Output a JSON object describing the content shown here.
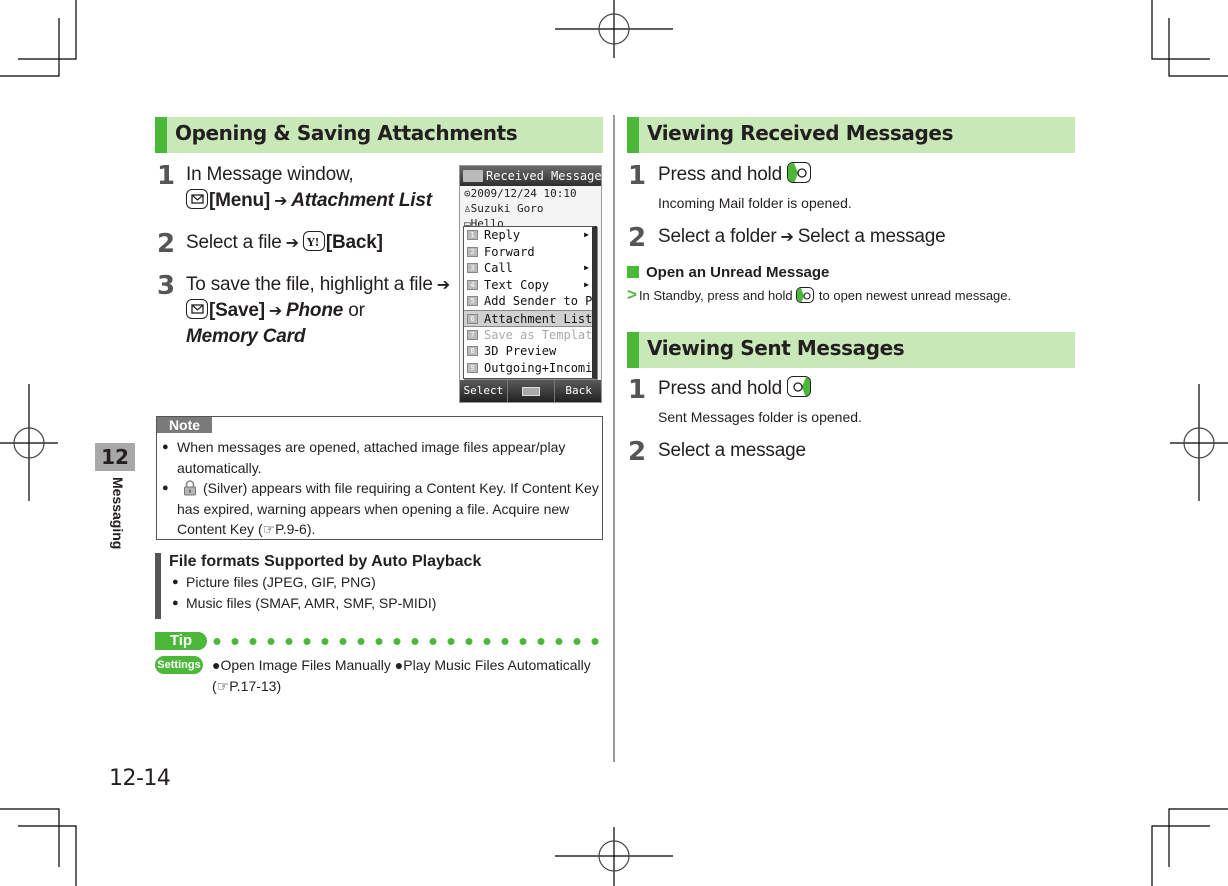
{
  "page": {
    "number": "12-14",
    "chapter_number": "12",
    "chapter_label": "Messaging"
  },
  "left": {
    "section_title": "Opening & Saving Attachments",
    "steps": [
      {
        "num": "1",
        "line1": "In Message window,",
        "key1_icon": "mail-key-icon",
        "key1_label": "[Menu]",
        "target": "Attachment List"
      },
      {
        "num": "2",
        "text": "Select a file",
        "key_icon": "yahoo-key-icon",
        "key_label": "[Back]"
      },
      {
        "num": "3",
        "line1": "To save the file, highlight a file",
        "key_icon": "mail-key-icon",
        "key_label": "[Save]",
        "option1": "Phone",
        "or": "or",
        "option2": "Memory Card"
      }
    ],
    "phone_screen": {
      "title": "Received Message",
      "date": "2009/12/24 10:10",
      "sender": "Suzuki Goro",
      "subject_partial": "Hello",
      "menu": [
        {
          "num": "1",
          "label": "Reply",
          "submenu": true
        },
        {
          "num": "2",
          "label": "Forward",
          "submenu": false
        },
        {
          "num": "3",
          "label": "Call",
          "submenu": true
        },
        {
          "num": "4",
          "label": "Text Copy",
          "submenu": true
        },
        {
          "num": "5",
          "label": "Add Sender to Ph",
          "submenu": false
        },
        {
          "num": "6",
          "label": "Attachment List",
          "submenu": false,
          "selected": true
        },
        {
          "num": "7",
          "label": "Save as Template",
          "submenu": false,
          "disabled": true
        },
        {
          "num": "8",
          "label": "3D Preview",
          "submenu": false
        },
        {
          "num": "9",
          "label": "Outgoing+Incomin",
          "submenu": false
        }
      ],
      "softkeys": {
        "left": "Select",
        "right": "Back"
      }
    },
    "note": {
      "tag": "Note",
      "items": [
        "When messages are opened, attached image files appear/play automatically.",
        "(Silver) appears with file requiring a Content Key. If Content Key has expired, warning appears when opening a file. Acquire new Content Key ("
      ],
      "ref": "P.9-6",
      "ref_close": ")."
    },
    "file_formats": {
      "title": "File formats Supported by Auto Playback",
      "items": [
        "Picture files (JPEG, GIF, PNG)",
        "Music files (SMAF, AMR, SMF, SP-MIDI)"
      ]
    },
    "tip": {
      "tag": "Tip",
      "settings_tag": "Settings",
      "item1": "Open Image Files Manually",
      "item2": "Play Music Files Automatically",
      "ref_open": "(",
      "ref": "P.17-13",
      "ref_close": ")"
    }
  },
  "right": {
    "received": {
      "section_title": "Viewing Received Messages",
      "step1": {
        "num": "1",
        "text": "Press and hold",
        "key_icon": "left-side-key-icon",
        "sub": "Incoming Mail folder is opened."
      },
      "step2": {
        "num": "2",
        "text1": "Select a folder",
        "text2": "Select a message"
      },
      "unread": {
        "title": "Open an Unread Message",
        "text1": "In Standby, press and hold",
        "text2": "to open newest unread message."
      }
    },
    "sent": {
      "section_title": "Viewing Sent Messages",
      "step1": {
        "num": "1",
        "text": "Press and hold",
        "key_icon": "right-side-key-icon",
        "sub": "Sent Messages folder is opened."
      },
      "step2": {
        "num": "2",
        "text": "Select a message"
      }
    }
  },
  "colors": {
    "accent_green": "#4cb83a",
    "header_bg": "#c9e8b8",
    "note_tag_bg": "#7a7a7a",
    "chapter_tab_bg": "#a8a8a8"
  }
}
